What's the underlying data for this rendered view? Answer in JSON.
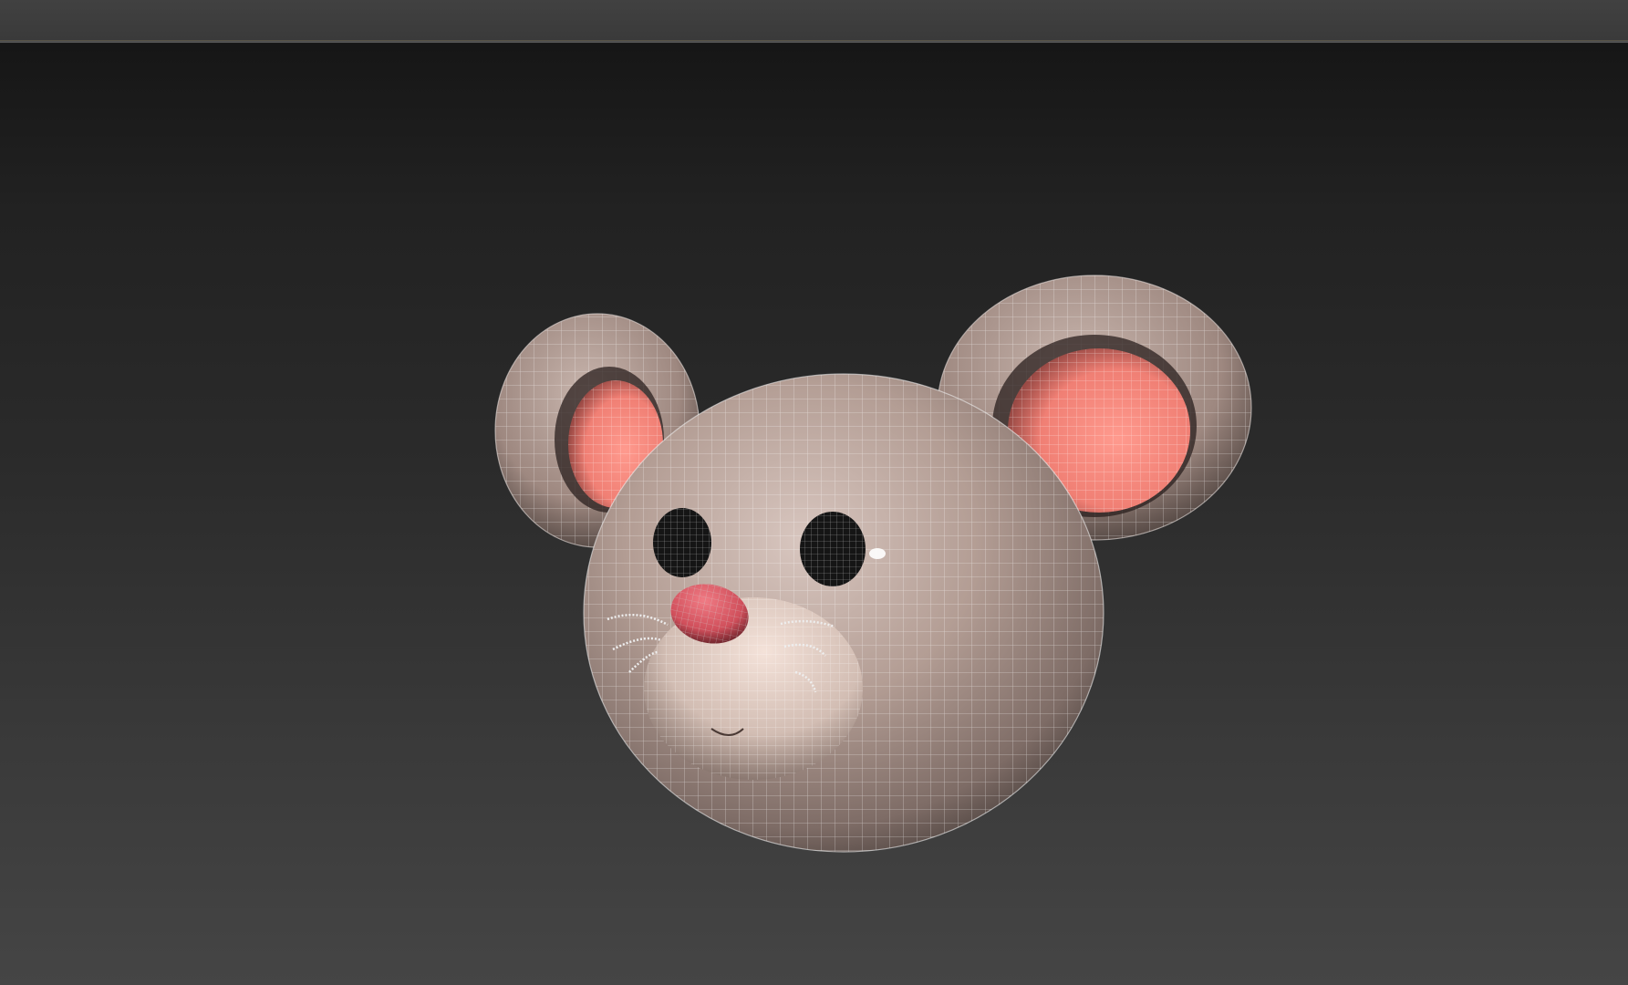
{
  "colors": {
    "title_bar": "#3d3d3d",
    "viewport_top": "#161616",
    "viewport_bottom": "#454545",
    "fur": "#a58f86",
    "fur_light": "#d6c4bc",
    "ear_inner": "#f07f74",
    "nose": "#d9515e",
    "eye": "#151515",
    "wire": "#ffffff"
  },
  "icons": {
    "model": "mouse-head-model-icon"
  }
}
